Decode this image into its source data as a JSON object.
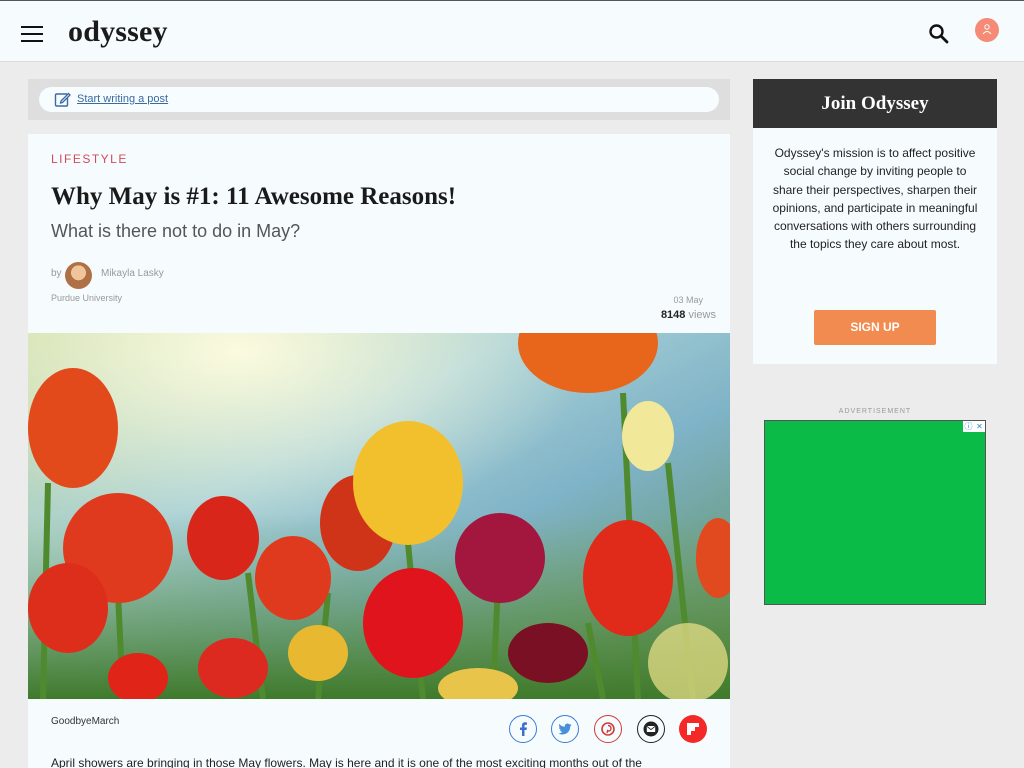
{
  "header": {
    "logo": "odyssey"
  },
  "writebar": {
    "link_label": "Start writing a post"
  },
  "article": {
    "category": "LIFESTYLE",
    "title": "Why May is #1: 11 Awesome Reasons!",
    "subtitle": "What is there not to do in May?",
    "by_label": "by",
    "author": "Mikayla Lasky",
    "school": "Purdue University",
    "date": "03 May",
    "views_count": "8148",
    "views_label": "views",
    "photo_credit": "GoodbyeMarch",
    "body_first_line": "April showers are bringing in those May flowers. May is here and it is one of the most exciting months out of the"
  },
  "sidebar": {
    "join_title": "Join Odyssey",
    "join_text": "Odyssey's mission is to affect positive social change by inviting people to share their perspectives, sharpen their opinions, and participate in meaningful conversations with others surrounding the topics they care about most.",
    "signup_label": "SIGN UP",
    "ad_label": "ADVERTISEMENT"
  },
  "colors": {
    "accent": "#d14b5a",
    "signup": "#f28b4f",
    "ad": "#0bbb47",
    "flipboard": "#f52828"
  }
}
